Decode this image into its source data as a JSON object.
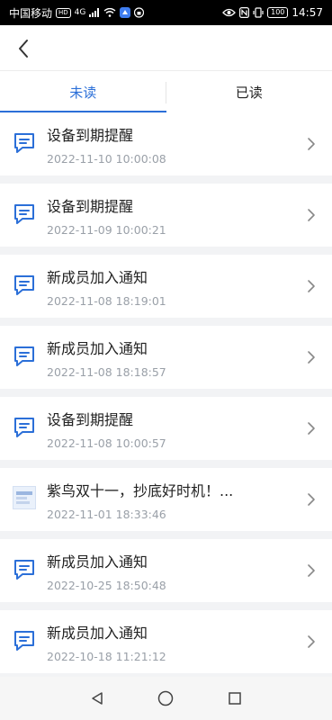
{
  "status_bar": {
    "carrier": "中国移动",
    "network_badge": "HD",
    "signal": "4G",
    "battery": "100",
    "time": "14:57"
  },
  "header": {
    "back_icon": "chevron-left-icon"
  },
  "tabs": [
    {
      "label": "未读",
      "active": true
    },
    {
      "label": "已读",
      "active": false
    }
  ],
  "accent_color": "#2b6fd8",
  "notifications": [
    {
      "title": "设备到期提醒",
      "time": "2022-11-10 10:00:08",
      "icon": "message-icon"
    },
    {
      "title": "设备到期提醒",
      "time": "2022-11-09 10:00:21",
      "icon": "message-icon"
    },
    {
      "title": "新成员加入通知",
      "time": "2022-11-08 18:19:01",
      "icon": "message-icon"
    },
    {
      "title": "新成员加入通知",
      "time": "2022-11-08 18:18:57",
      "icon": "message-icon"
    },
    {
      "title": "设备到期提醒",
      "time": "2022-11-08 10:00:57",
      "icon": "message-icon"
    },
    {
      "title": "紫鸟双十一，抄底好时机！...",
      "time": "2022-11-01 18:33:46",
      "icon": "thumbnail-image"
    },
    {
      "title": "新成员加入通知",
      "time": "2022-10-25 18:50:48",
      "icon": "message-icon"
    },
    {
      "title": "新成员加入通知",
      "time": "2022-10-18 11:21:12",
      "icon": "message-icon"
    }
  ]
}
